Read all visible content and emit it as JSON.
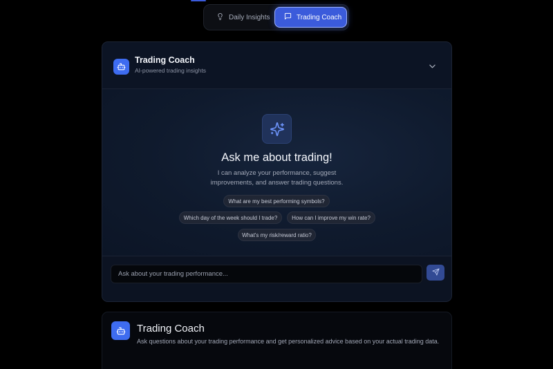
{
  "tabs": {
    "daily_insights": {
      "label": "Daily Insights",
      "icon": "lightbulb-icon"
    },
    "trading_coach": {
      "label": "Trading Coach",
      "icon": "message-square-icon",
      "active": true
    }
  },
  "chat_panel": {
    "title": "Trading Coach",
    "subtitle": "AI-powered trading insights",
    "header_icon": "bot-icon",
    "collapse_icon": "chevron-down-icon",
    "empty_state": {
      "icon": "sparkles-icon",
      "heading": "Ask me about trading!",
      "description": "I can analyze your performance, suggest improvements, and answer trading questions."
    },
    "suggestions": [
      "What are my best performing symbols?",
      "Which day of the week should I trade?",
      "How can I improve my win rate?",
      "What's my risk/reward ratio?"
    ],
    "input": {
      "placeholder": "Ask about your trading performance...",
      "value": ""
    },
    "send_icon": "send-icon"
  },
  "info_card": {
    "icon": "bot-icon",
    "title": "Trading Coach",
    "description": "Ask questions about your trading performance and get personalized advice based on your actual trading data."
  },
  "colors": {
    "accent": "#3b5bdb",
    "icon_blue": "#3e6cf0",
    "background": "#000000",
    "panel": "#0b1120"
  }
}
